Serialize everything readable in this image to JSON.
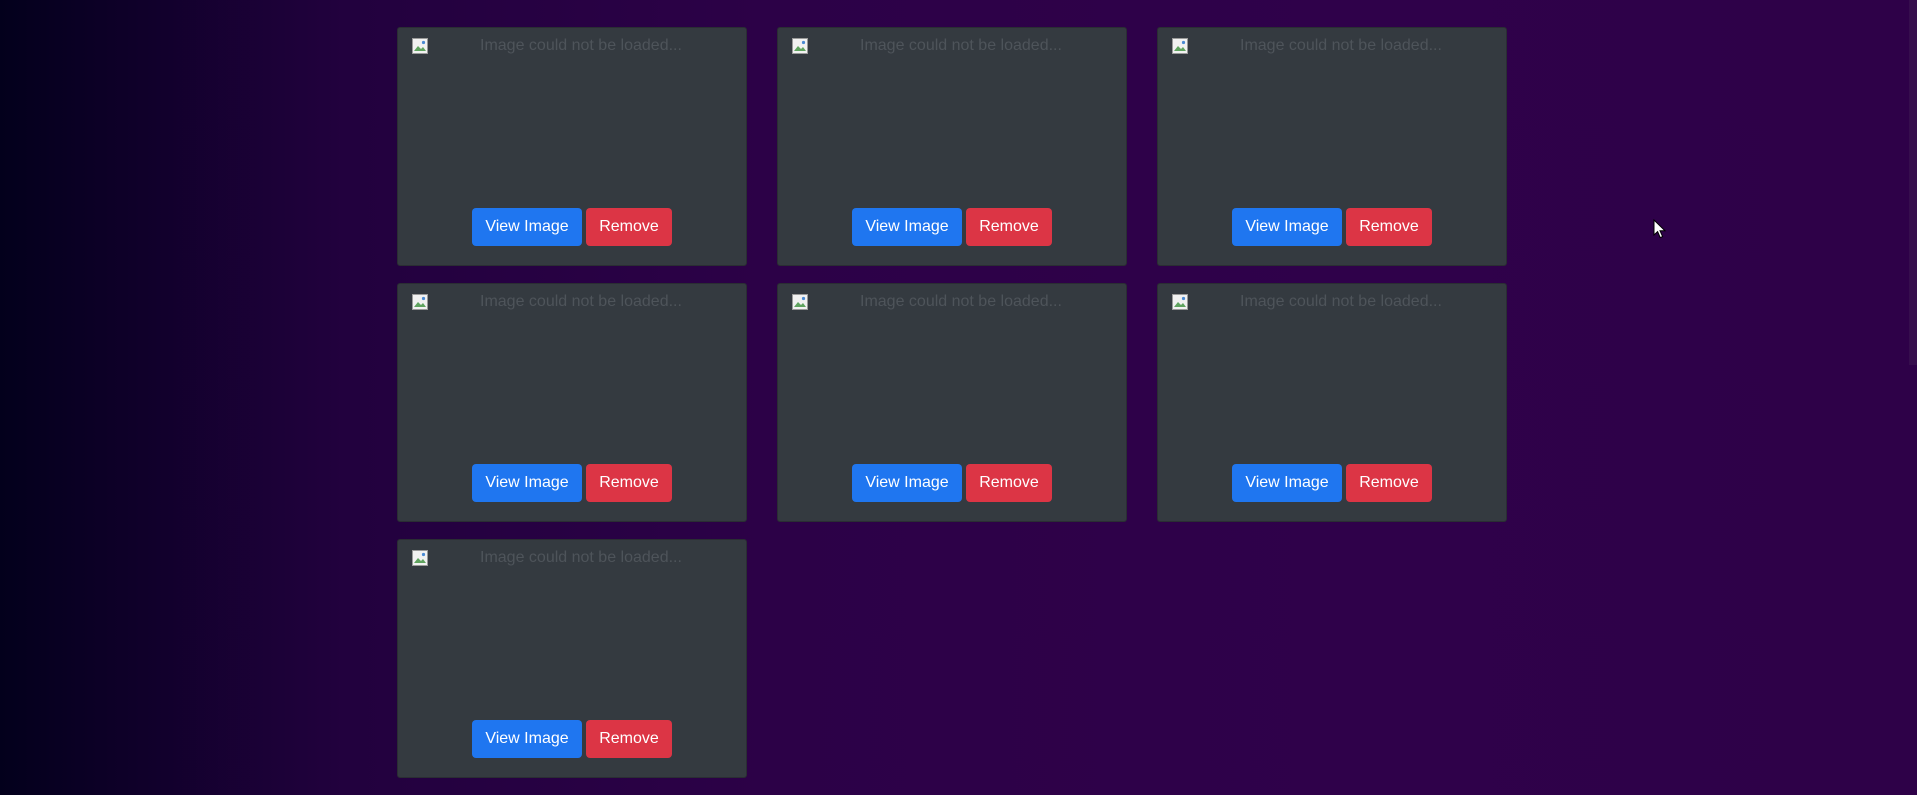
{
  "gallery": {
    "items": [
      {
        "alt": "Image could not be loaded...",
        "view_label": "View Image",
        "remove_label": "Remove"
      },
      {
        "alt": "Image could not be loaded...",
        "view_label": "View Image",
        "remove_label": "Remove"
      },
      {
        "alt": "Image could not be loaded...",
        "view_label": "View Image",
        "remove_label": "Remove"
      },
      {
        "alt": "Image could not be loaded...",
        "view_label": "View Image",
        "remove_label": "Remove"
      },
      {
        "alt": "Image could not be loaded...",
        "view_label": "View Image",
        "remove_label": "Remove"
      },
      {
        "alt": "Image could not be loaded...",
        "view_label": "View Image",
        "remove_label": "Remove"
      },
      {
        "alt": "Image could not be loaded...",
        "view_label": "View Image",
        "remove_label": "Remove"
      }
    ]
  },
  "icons": {
    "broken_image": "broken-image-icon",
    "cursor": "mouse-pointer-icon"
  },
  "colors": {
    "card_bg": "#343a40",
    "view_button": "#1f76f0",
    "remove_button": "#dc3545",
    "alt_text": "#4e545a"
  }
}
